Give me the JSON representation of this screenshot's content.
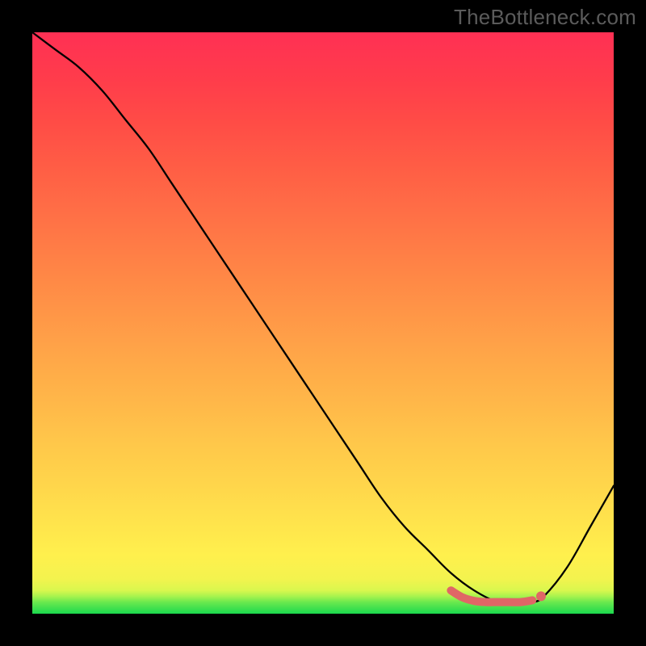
{
  "watermark": "TheBottleneck.com",
  "chart_data": {
    "type": "line",
    "title": "",
    "xlabel": "",
    "ylabel": "",
    "xlim": [
      0,
      100
    ],
    "ylim": [
      0,
      100
    ],
    "series": [
      {
        "name": "bottleneck-curve",
        "x": [
          0,
          4,
          8,
          12,
          16,
          20,
          24,
          28,
          32,
          36,
          40,
          44,
          48,
          52,
          56,
          60,
          64,
          68,
          72,
          76,
          80,
          82,
          84,
          86,
          88,
          92,
          96,
          100
        ],
        "y": [
          100,
          97,
          94,
          90,
          85,
          80,
          74,
          68,
          62,
          56,
          50,
          44,
          38,
          32,
          26,
          20,
          15,
          11,
          7,
          4,
          2,
          2,
          2,
          2,
          3,
          8,
          15,
          22
        ]
      }
    ],
    "highlight": {
      "name": "optimal-zone",
      "x": [
        72,
        74,
        76,
        78,
        80,
        82,
        84,
        86
      ],
      "y": [
        4.0,
        2.8,
        2.2,
        2.0,
        2.0,
        2.0,
        2.0,
        2.3
      ]
    },
    "highlight_dot": {
      "x": 87.5,
      "y": 3.0
    }
  },
  "colors": {
    "curve": "#000000",
    "highlight": "#e06666",
    "gradient_top": "#ff3054",
    "gradient_bottom": "#1bd94e",
    "frame": "#000000"
  }
}
